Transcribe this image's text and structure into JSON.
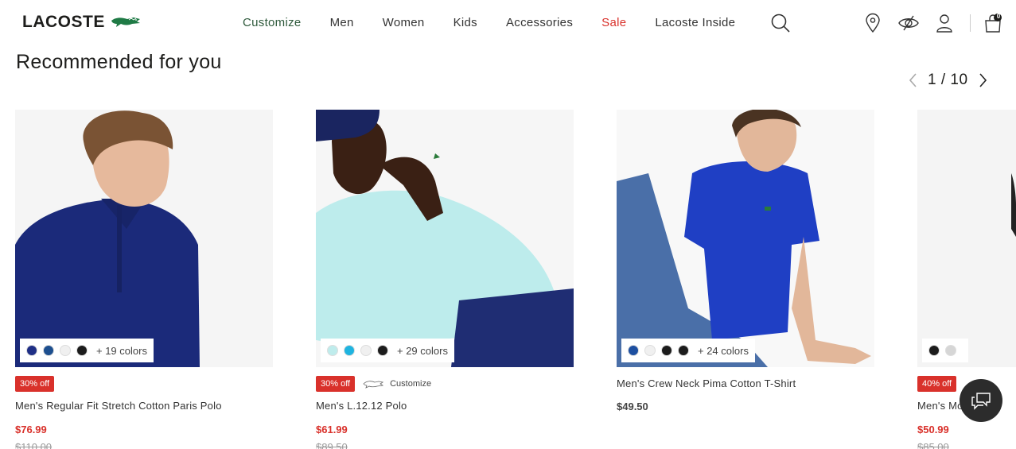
{
  "brand": {
    "name": "LACOSTE"
  },
  "nav": {
    "items": [
      {
        "label": "Customize",
        "key": "customize"
      },
      {
        "label": "Men",
        "key": "men"
      },
      {
        "label": "Women",
        "key": "women"
      },
      {
        "label": "Kids",
        "key": "kids"
      },
      {
        "label": "Accessories",
        "key": "accessories"
      },
      {
        "label": "Sale",
        "key": "sale"
      },
      {
        "label": "Lacoste Inside",
        "key": "inside"
      }
    ],
    "icons": [
      "search-icon",
      "store-locator-icon",
      "eye-icon",
      "account-icon",
      "cart-icon"
    ],
    "cart_count": "0"
  },
  "section": {
    "title": "Recommended for you",
    "pager": "1 / 10"
  },
  "products": [
    {
      "name": "Men's Regular Fit Stretch Cotton Paris Polo",
      "discount": "30% off",
      "price": "$76.99",
      "original_price": "$110.00",
      "more_colors": "+ 19 colors",
      "swatches": [
        "#1f2f86",
        "#1d4f8f",
        "#f0f0f0",
        "#1c1c1c"
      ]
    },
    {
      "name": "Men's L.12.12 Polo",
      "discount": "30% off",
      "customize": "Customize",
      "price": "$61.99",
      "original_price": "$89.50",
      "more_colors": "+ 29 colors",
      "swatches": [
        "#bfecec",
        "#1fb4e0",
        "#f0f0f0",
        "#1c1c1c"
      ]
    },
    {
      "name": "Men's Crew Neck Pima Cotton T-Shirt",
      "price": "$49.50",
      "more_colors": "+ 24 colors",
      "swatches": [
        "#1d4fa0",
        "#f0f0f0",
        "#1c1c1c",
        "#1c1c1c"
      ]
    },
    {
      "name": "Men's Mo",
      "discount": "40% off",
      "price": "$50.99",
      "original_price": "$85.00",
      "swatches": [
        "#1c1c1c",
        "#d6d6d6"
      ]
    }
  ],
  "colors": {
    "accent_red": "#d9312b",
    "customize_green": "#2f5a3c",
    "brand_green": "#1f7a45"
  }
}
